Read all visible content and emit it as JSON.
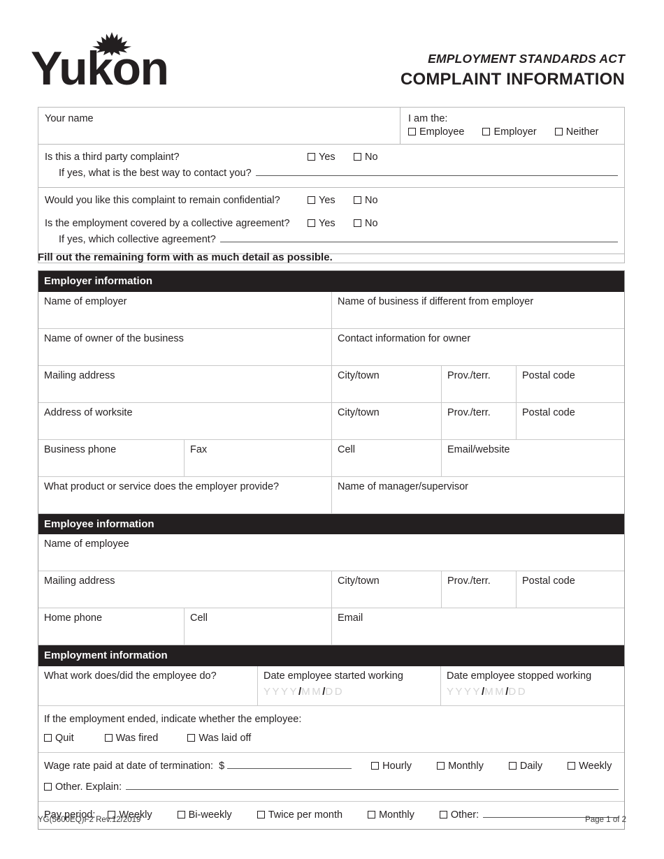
{
  "header": {
    "logo_text": "Yukon",
    "logo_icon": "sunburst-icon",
    "act_title": "EMPLOYMENT STANDARDS ACT",
    "form_title": "COMPLAINT INFORMATION"
  },
  "top_box": {
    "your_name_label": "Your name",
    "i_am_the_label": "I am the:",
    "i_am_options": [
      "Employee",
      "Employer",
      "Neither"
    ],
    "q_third_party": "Is this a third party complaint?",
    "q_third_party_sub": "If yes, what is the best way to contact you?",
    "q_confidential": "Would you like this complaint to remain confidential?",
    "q_collective": "Is the employment covered by a collective agreement?",
    "q_collective_sub": "If yes, which collective agreement?",
    "yes_label": "Yes",
    "no_label": "No"
  },
  "instruction": "Fill out the remaining form with as much detail as possible.",
  "employer_section": {
    "heading": "Employer information",
    "name_of_employer": "Name of employer",
    "name_of_business": "Name of business if different from employer",
    "name_of_owner": "Name of owner of the business",
    "contact_for_owner": "Contact information for owner",
    "mailing_address": "Mailing address",
    "city_town": "City/town",
    "prov_terr": "Prov./terr.",
    "postal_code": "Postal code",
    "address_of_worksite": "Address of worksite",
    "city_town_2": "City/town",
    "prov_terr_2": "Prov./terr.",
    "postal_code_2": "Postal code",
    "business_phone": "Business phone",
    "fax": "Fax",
    "cell": "Cell",
    "email_website": "Email/website",
    "product_service": "What product or service does the employer provide?",
    "manager_supervisor": "Name of manager/supervisor"
  },
  "employee_section": {
    "heading": "Employee information",
    "name_of_employee": "Name of employee",
    "mailing_address": "Mailing address",
    "city_town": "City/town",
    "prov_terr": "Prov./terr.",
    "postal_code": "Postal code",
    "home_phone": "Home phone",
    "cell": "Cell",
    "email": "Email"
  },
  "employment_section": {
    "heading": "Employment information",
    "what_work": "What work does/did the employee do?",
    "date_started": "Date employee started working",
    "date_stopped": "Date employee stopped working",
    "date_hint_year": "YYYY",
    "date_hint_month": "MM",
    "date_hint_day": "DD",
    "date_hint_sep": "/",
    "ended_label": "If the employment ended, indicate whether the employee:",
    "ended_options": [
      "Quit",
      "Was fired",
      "Was laid off"
    ],
    "wage_label": "Wage rate paid at date of termination:",
    "wage_currency": "$",
    "wage_options": [
      "Hourly",
      "Monthly",
      "Daily",
      "Weekly"
    ],
    "other_explain": "Other. Explain:",
    "pay_period_label": "Pay period:",
    "pay_period_options": [
      "Weekly",
      "Bi-weekly",
      "Twice per month",
      "Monthly"
    ],
    "pay_period_other": "Other:"
  },
  "footer": {
    "form_code": "YG(5600EQ)F2 Rev.12/2019",
    "page_number": "Page 1 of 2"
  }
}
